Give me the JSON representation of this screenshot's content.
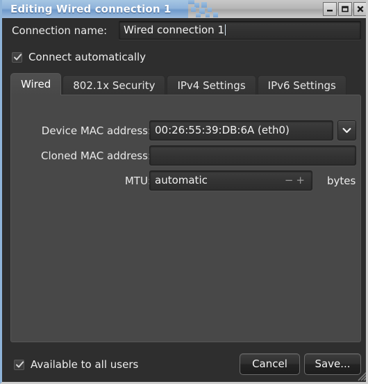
{
  "window": {
    "title": "Editing Wired connection 1",
    "controls": [
      {
        "name": "minimize-button",
        "glyph": "minimize"
      },
      {
        "name": "maximize-button",
        "glyph": "maximize"
      },
      {
        "name": "close-button",
        "glyph": "close"
      }
    ],
    "accent_blue": "#8fb3da",
    "background": "#2e2e2e"
  },
  "connection": {
    "name_label": "Connection name:",
    "name_value": "Wired connection 1",
    "name_placeholder": "Connection name",
    "autoconnect_label": "Connect automatically",
    "autoconnect_checked": true
  },
  "tabs": [
    {
      "label": "Wired",
      "active": true
    },
    {
      "label": "802.1x Security",
      "active": false
    },
    {
      "label": "IPv4 Settings",
      "active": false
    },
    {
      "label": "IPv6 Settings",
      "active": false
    }
  ],
  "wired": {
    "device_mac_label": "Device MAC address:",
    "device_mac_value": "00:26:55:39:DB:6A (eth0)",
    "device_mac_options": [
      "00:26:55:39:DB:6A (eth0)"
    ],
    "cloned_mac_label": "Cloned MAC address:",
    "cloned_mac_value": "",
    "cloned_mac_placeholder": "",
    "mtu_label": "MTU:",
    "mtu_value": "automatic",
    "mtu_units": "bytes",
    "mtu_decrement": "−",
    "mtu_increment": "+"
  },
  "footer": {
    "available_all_users_label": "Available to all users",
    "available_all_users_checked": true,
    "cancel_label": "Cancel",
    "save_label": "Save..."
  }
}
